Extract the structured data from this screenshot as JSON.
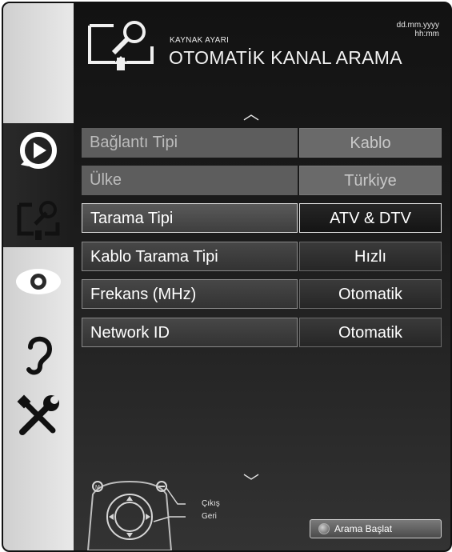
{
  "header": {
    "subtitle": "KAYNAK AYARI",
    "title": "OTOMATİK KANAL ARAMA",
    "date": "dd.mm.yyyy",
    "time": "hh:mm"
  },
  "sidebar": {
    "items": [
      {
        "name": "source-icon",
        "active": false
      },
      {
        "name": "tv-settings-icon",
        "active": true
      },
      {
        "name": "picture-icon",
        "active": false
      },
      {
        "name": "sound-icon",
        "active": false
      },
      {
        "name": "tools-icon",
        "active": false
      }
    ]
  },
  "menu": {
    "up_arrow": "︿",
    "down_arrow": "﹀",
    "rows": [
      {
        "label": "Bağlantı Tipi",
        "value": "Kablo",
        "state": "disabled"
      },
      {
        "label": "Ülke",
        "value": "Türkiye",
        "state": "disabled"
      },
      {
        "label": "Tarama Tipi",
        "value": "ATV & DTV",
        "state": "selected"
      },
      {
        "label": "Kablo Tarama Tipi",
        "value": "Hızlı",
        "state": "normal"
      },
      {
        "label": "Frekans (MHz)",
        "value": "Otomatik",
        "state": "normal"
      },
      {
        "label": "Network ID",
        "value": "Otomatik",
        "state": "normal"
      }
    ]
  },
  "footer": {
    "exit_label": "Çıkış",
    "back_label": "Geri",
    "start_button": "Arama Başlat"
  }
}
